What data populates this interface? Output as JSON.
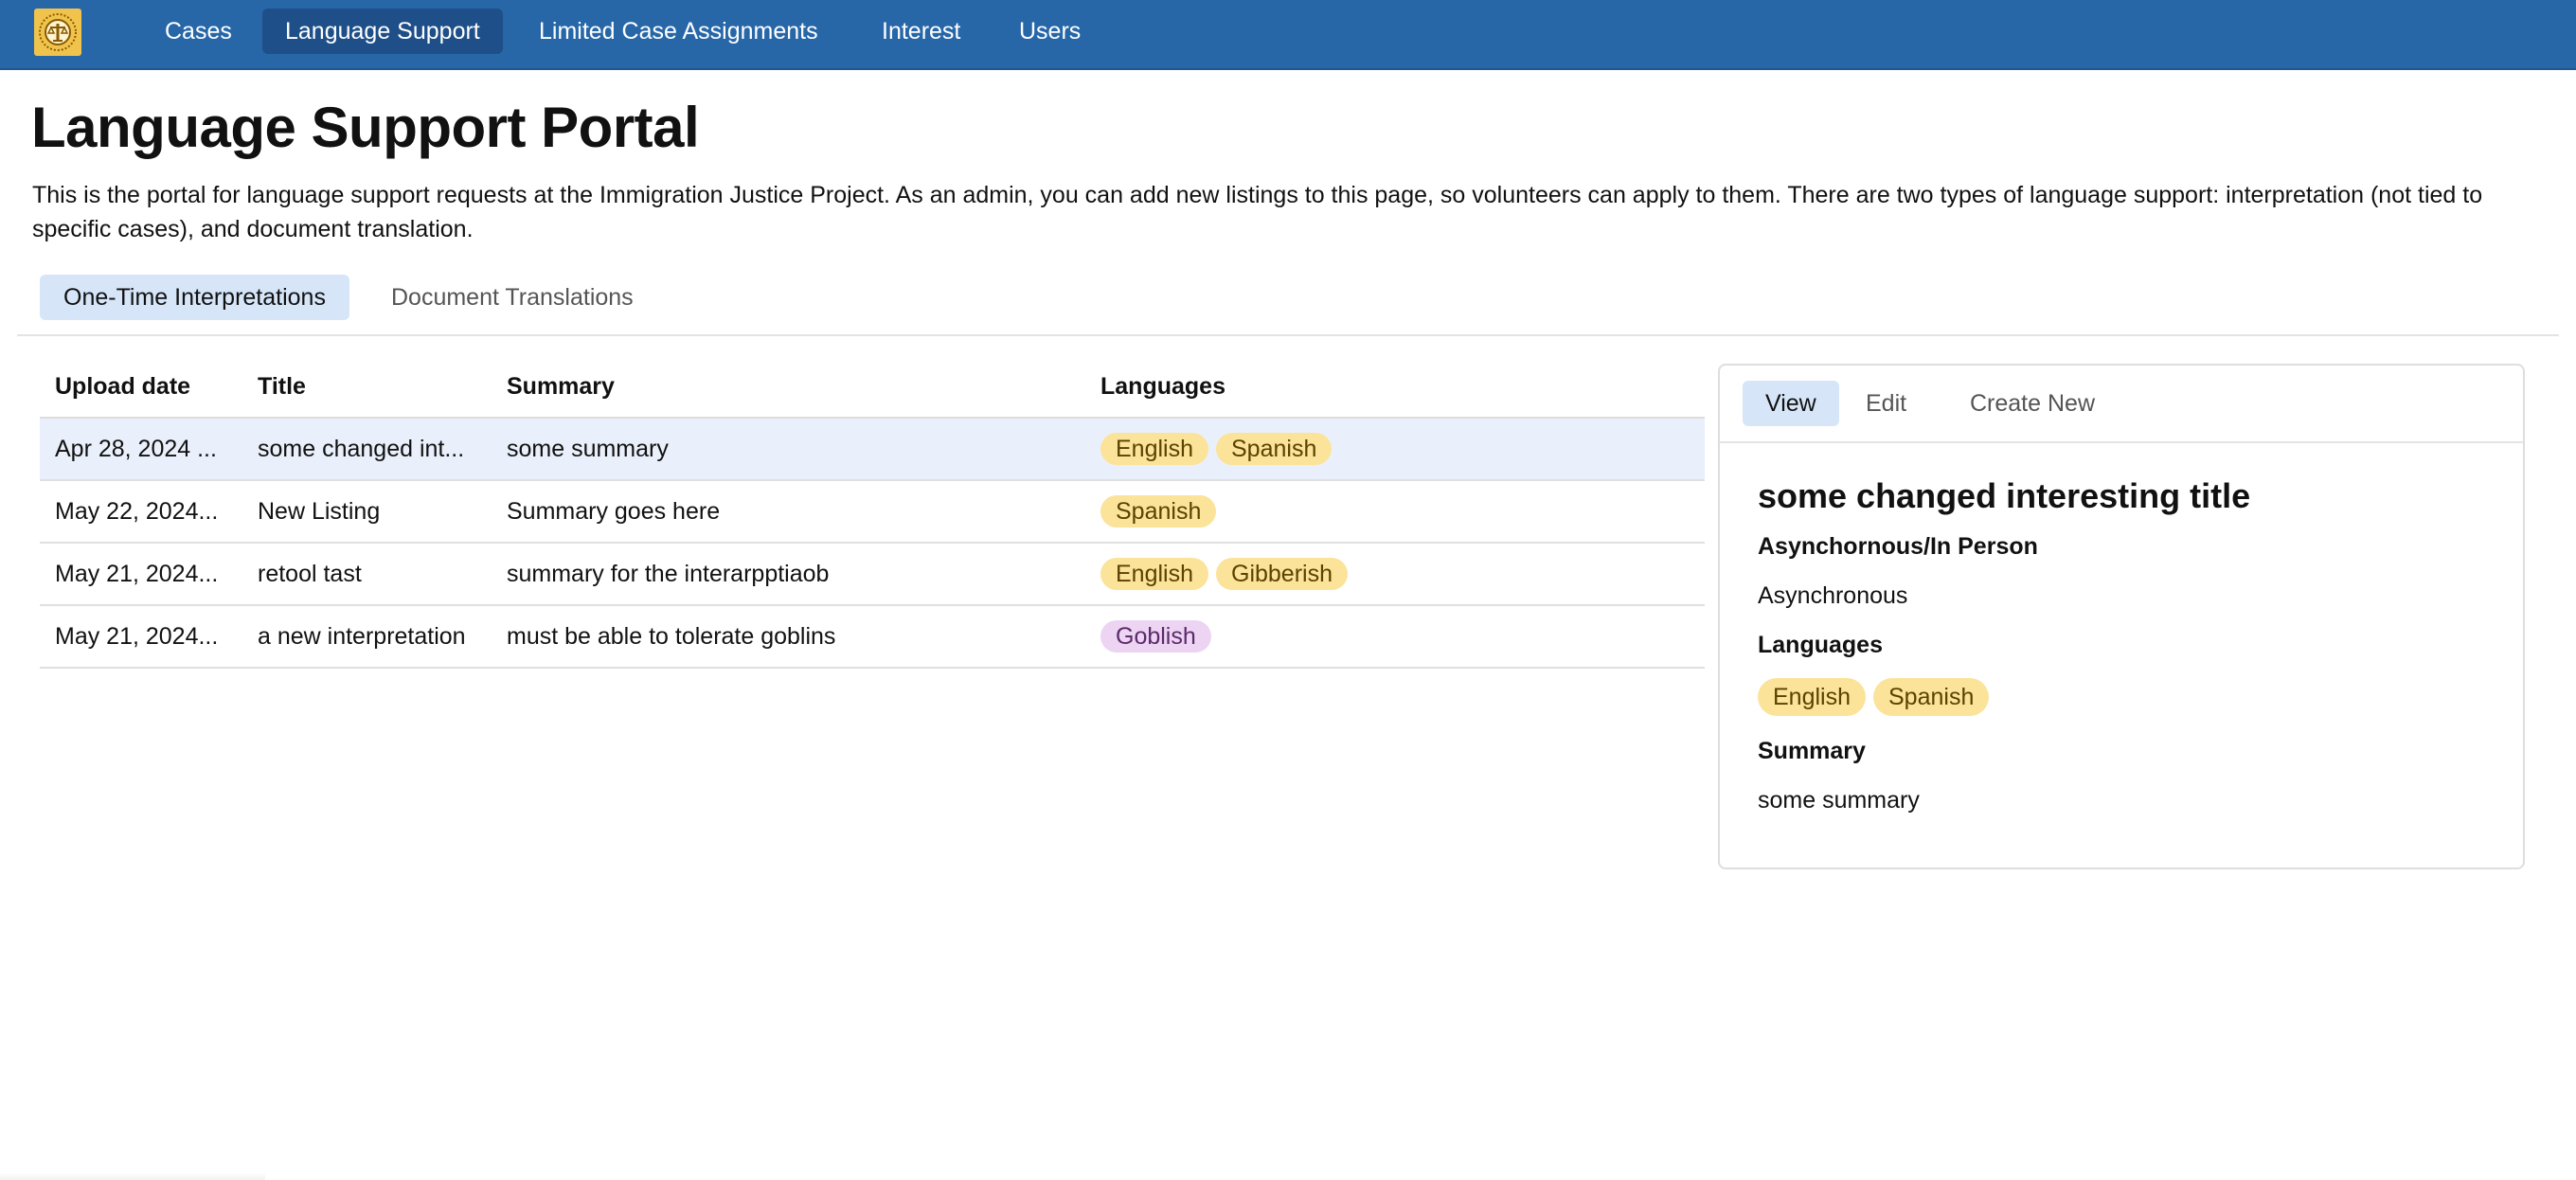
{
  "nav": {
    "logo_icon": "scales-of-justice-logo-icon",
    "items": [
      {
        "label": "Cases",
        "active": false
      },
      {
        "label": "Language Support",
        "active": true
      },
      {
        "label": "Limited Case Assignments",
        "active": false
      },
      {
        "label": "Interest",
        "active": false
      },
      {
        "label": "Users",
        "active": false
      }
    ]
  },
  "page": {
    "title": "Language Support Portal",
    "description": "This is the portal for language support requests at the Immigration Justice Project. As an admin, you can add new listings to this page, so volunteers can apply to them. There are two types of language support: interpretation (not tied to specific cases), and document translation."
  },
  "tabs": [
    {
      "label": "One-Time Interpretations",
      "active": true
    },
    {
      "label": "Document Translations",
      "active": false
    }
  ],
  "table": {
    "headers": {
      "date": "Upload date",
      "title": "Title",
      "summary": "Summary",
      "languages": "Languages"
    },
    "rows": [
      {
        "date": "Apr 28, 2024 ...",
        "title": "some changed int...",
        "summary": "some summary",
        "languages": [
          {
            "name": "English",
            "color": "yellow"
          },
          {
            "name": "Spanish",
            "color": "yellow"
          }
        ],
        "selected": true
      },
      {
        "date": "May 22, 2024...",
        "title": "New Listing",
        "summary": "Summary goes here",
        "languages": [
          {
            "name": "Spanish",
            "color": "yellow"
          }
        ],
        "selected": false
      },
      {
        "date": "May 21, 2024...",
        "title": "retool tast",
        "summary": "summary for the interarpptiaob",
        "languages": [
          {
            "name": "English",
            "color": "yellow"
          },
          {
            "name": "Gibberish",
            "color": "yellow"
          }
        ],
        "selected": false
      },
      {
        "date": "May 21, 2024...",
        "title": "a new interpretation",
        "summary": "must be able to tolerate goblins",
        "languages": [
          {
            "name": "Goblish",
            "color": "purple"
          }
        ],
        "selected": false
      }
    ]
  },
  "detail": {
    "tabs": [
      {
        "label": "View",
        "active": true
      },
      {
        "label": "Edit",
        "active": false
      },
      {
        "label": "Create New",
        "active": false
      }
    ],
    "title": "some changed interesting title",
    "mode_label": "Asynchornous/In Person",
    "mode_value": "Asynchronous",
    "languages_label": "Languages",
    "languages": [
      "English",
      "Spanish"
    ],
    "summary_label": "Summary",
    "summary_value": "some summary"
  },
  "colors": {
    "nav_bg": "#2767a8",
    "nav_active": "#1f4f88",
    "tab_active_bg": "#d6e5f8",
    "row_selected": "#eaf0fb",
    "pill_yellow": "#fbe39a",
    "pill_purple": "#ecd4f2"
  }
}
